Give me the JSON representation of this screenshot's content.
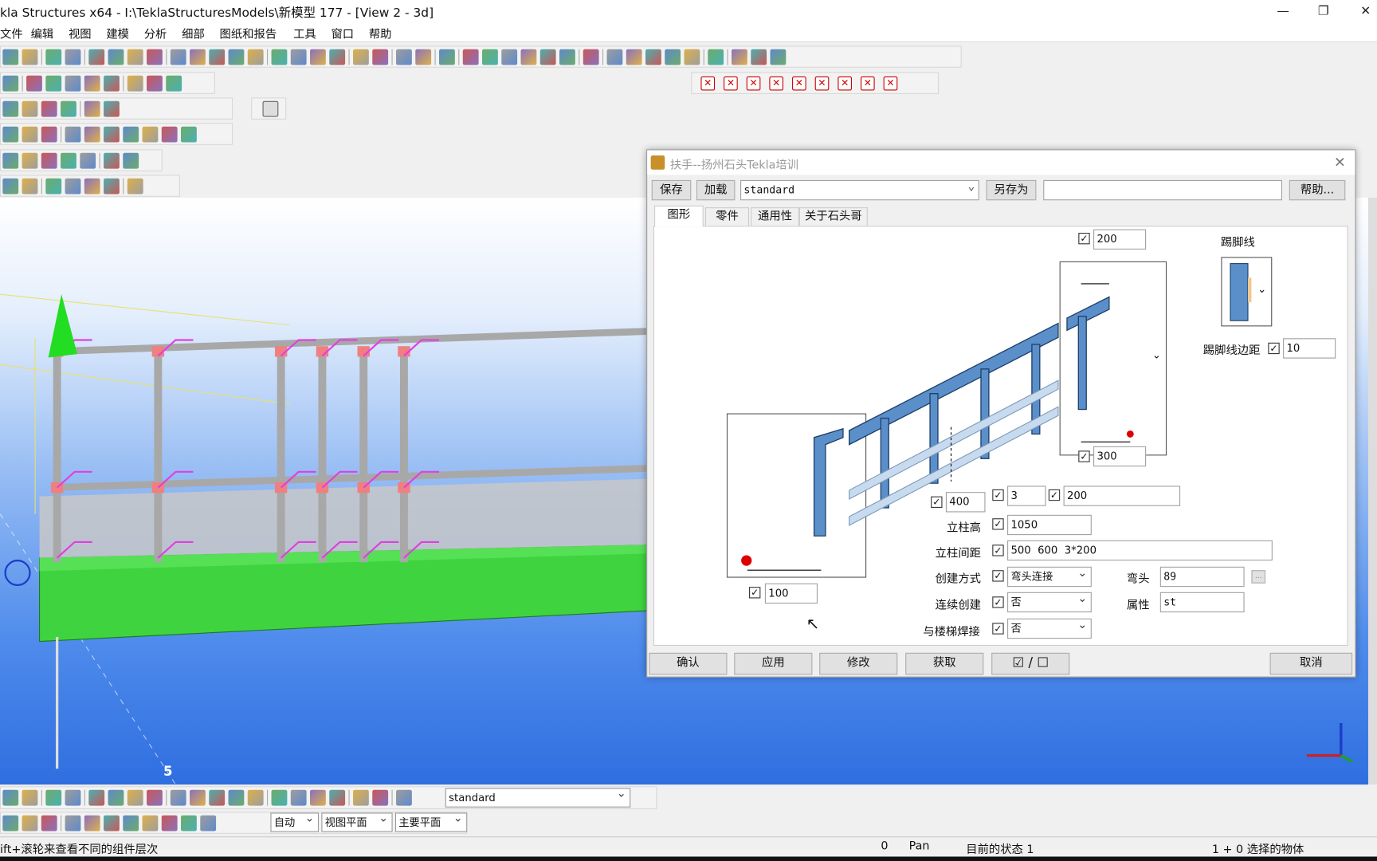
{
  "window": {
    "title": "kla Structures x64 - I:\\TeklaStructuresModels\\新模型 177  - [View 2 - 3d]",
    "minimize": "—",
    "restore": "❐",
    "close": "✕"
  },
  "menu": [
    "文件",
    "编辑",
    "视图",
    "建模",
    "分析",
    "细部",
    "图纸和报告",
    "工具",
    "窗口",
    "帮助"
  ],
  "toolbars": {
    "row1": [
      "open",
      "save",
      "|",
      "undo",
      "redo",
      "|",
      "copy",
      "paste",
      "report",
      "template",
      "|",
      "view",
      "view2",
      "list",
      "cut",
      "select",
      "|",
      "drawing",
      "dwg2",
      "dwg3",
      "dwg4",
      "|",
      "render",
      "render2",
      "|",
      "grid",
      "grid2",
      "|",
      "help",
      "|",
      "point",
      "point2",
      "point3",
      "point4",
      "arc",
      "point5",
      "|",
      "inquire",
      "|",
      "model",
      "model2",
      "model3",
      "model4",
      "model5",
      "|",
      "component",
      "|",
      "more",
      "more2",
      "more3"
    ],
    "row2": [
      "plate",
      "|",
      "column",
      "beam",
      "polybeam",
      "slab",
      "panel",
      "|",
      "bolt",
      "weld",
      "mesh"
    ],
    "row3": [
      "beam",
      "polybeam",
      "curved",
      "twin",
      "|",
      "bolt",
      "weld"
    ],
    "row4": [
      "stair",
      "component",
      "pad",
      "|",
      "rebar",
      "rebar2",
      "surface",
      "cut",
      "group",
      "group2",
      "group3"
    ],
    "row5": [
      "snap",
      "snap2",
      "snap3",
      "snap4",
      "snap5",
      "|",
      "snap6",
      "snap7"
    ],
    "row6": [
      "shape",
      "shape2",
      "|",
      "plane",
      "plane2",
      "plane3",
      "plane4",
      "|",
      "refresh"
    ],
    "floating": [
      "delete-x",
      "delete-x",
      "delete-x",
      "delete-x",
      "delete-x",
      "delete-x",
      "delete-x",
      "delete-x",
      "delete-x"
    ]
  },
  "dialog": {
    "title": "扶手--扬州石头Tekla培训",
    "save": "保存",
    "load": "加载",
    "preset": "standard",
    "save_as": "另存为",
    "save_as_name": "",
    "help": "帮助...",
    "tabs": [
      "图形",
      "零件",
      "通用性",
      "关于石头哥"
    ],
    "fields": {
      "top_offset": "200",
      "end_offset": "300",
      "rail_count": "3",
      "rail_spacing": "200",
      "bottom_gap": "400",
      "start_offset": "100",
      "kick_label": "踢脚线",
      "kick_dist_label": "踢脚线边距",
      "kick_dist": "10",
      "post_height_label": "立柱高",
      "post_height": "1050",
      "post_spacing_label": "立柱间距",
      "post_spacing": "500  600  3*200",
      "create_mode_label": "创建方式",
      "create_mode": "弯头连接",
      "elbow_label": "弯头",
      "elbow": "89",
      "elbow_btn": "...",
      "continuous_label": "连续创建",
      "continuous": "否",
      "attr_label": "属性",
      "attr": "st",
      "weld_label": "与楼梯焊接",
      "weld": "否"
    },
    "buttons": {
      "ok": "确认",
      "apply": "应用",
      "modify": "修改",
      "get": "获取",
      "toggle": "☑ / ☐",
      "cancel": "取消"
    },
    "close": "✕"
  },
  "viewport": {
    "grid_label": "5",
    "colors": {
      "beam": "#3fd43f",
      "rail": "#a8a8a8",
      "handle": "#e040e0",
      "joint": "#f08080"
    }
  },
  "bottom_toolbar": {
    "preset": "standard",
    "snap_mode": "自动",
    "plane": "视图平面",
    "main_plane": "主要平面"
  },
  "status": {
    "hint": "ift+滚轮来查看不同的组件层次",
    "value": "0",
    "mode": "Pan",
    "state": "目前的状态 1",
    "selection": "1 + 0 选择的物体"
  }
}
